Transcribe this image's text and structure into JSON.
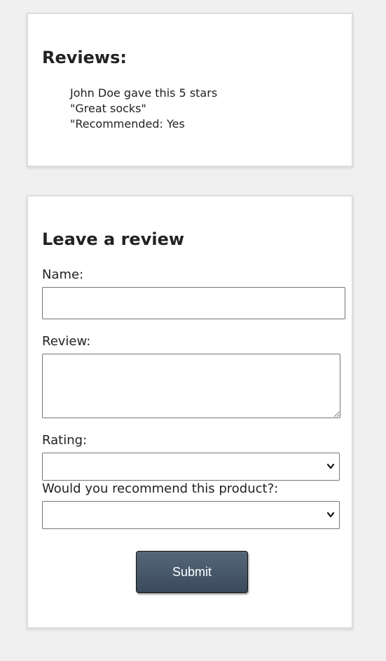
{
  "reviews": {
    "heading": "Reviews:",
    "items": [
      {
        "line1": "John Doe gave this 5 stars",
        "line2": "\"Great socks\"",
        "line3": "\"Recommended: Yes"
      }
    ]
  },
  "form": {
    "heading": "Leave a review",
    "name_label": "Name:",
    "name_value": "",
    "review_label": "Review:",
    "review_value": "",
    "rating_label": "Rating:",
    "rating_value": "",
    "recommend_label": "Would you recommend this product?:",
    "recommend_value": "",
    "submit_label": "Submit"
  },
  "colors": {
    "page_background": "#f0f0f0",
    "card_background": "#ffffff",
    "button_background": "#46566a",
    "button_text": "#ffffff"
  },
  "icons": {
    "select_arrow": "chevron-down-icon"
  }
}
